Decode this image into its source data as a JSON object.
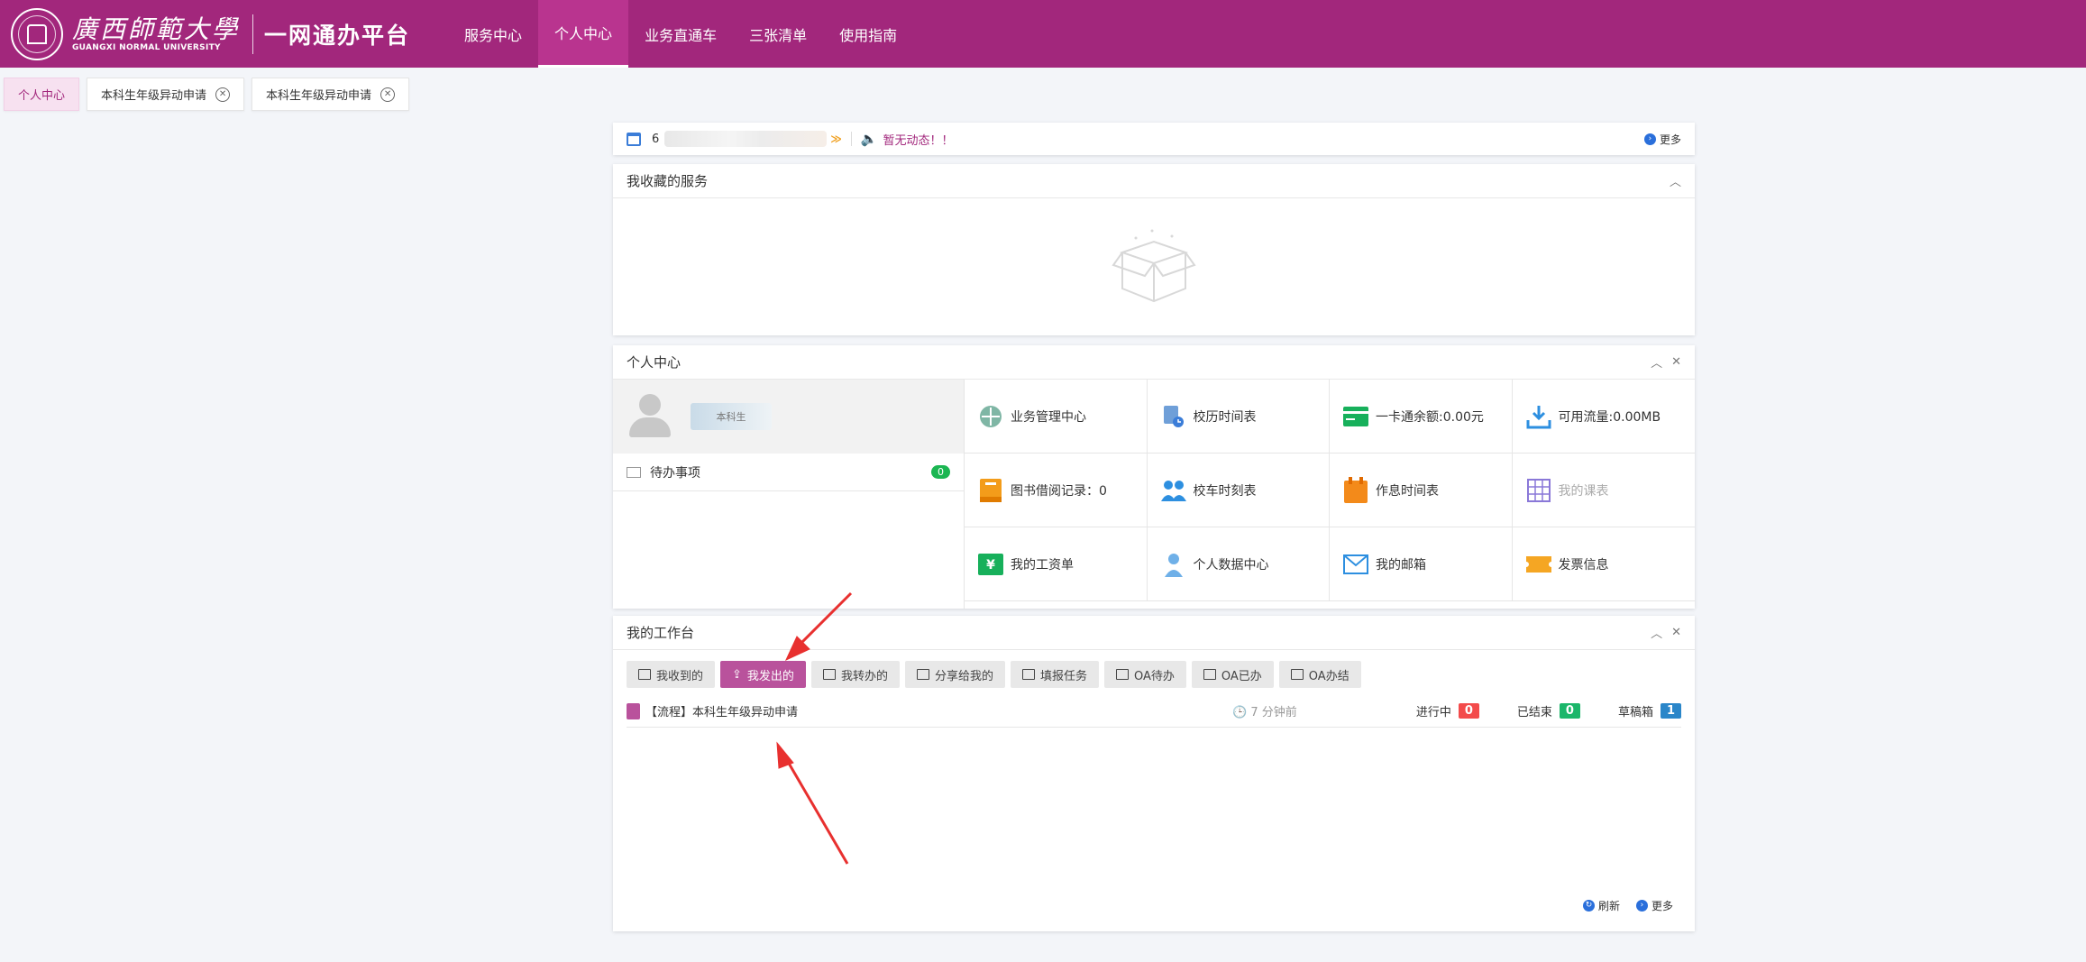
{
  "header": {
    "university_name": "廣西師範大學",
    "university_en": "GUANGXI NORMAL UNIVERSITY",
    "platform_title": "一网通办平台",
    "nav": [
      "服务中心",
      "个人中心",
      "业务直通车",
      "三张清单",
      "使用指南"
    ],
    "active_nav": "个人中心"
  },
  "tabs": [
    {
      "label": "个人中心",
      "active": true
    },
    {
      "label": "本科生年级异动申请",
      "active": false
    },
    {
      "label": "本科生年级异动申请",
      "active": false
    }
  ],
  "news": {
    "date_prefix": "6",
    "message": "暂无动态！！",
    "more": "更多"
  },
  "favorites": {
    "title": "我收藏的服务"
  },
  "personal": {
    "title": "个人中心",
    "user_role": "本科生",
    "todo_label": "待办事项",
    "todo_count": "0",
    "items": [
      {
        "label": "业务管理中心",
        "icon": "grid-circle-icon"
      },
      {
        "label": "校历时间表",
        "icon": "calendar-doc-icon"
      },
      {
        "label": "一卡通余额:0.00元",
        "icon": "card-icon"
      },
      {
        "label": "可用流量:0.00MB",
        "icon": "download-icon"
      },
      {
        "label": "图书借阅记录：0",
        "icon": "book-icon"
      },
      {
        "label": "校车时刻表",
        "icon": "people-icon"
      },
      {
        "label": "作息时间表",
        "icon": "schedule-icon"
      },
      {
        "label": "我的课表",
        "icon": "table-icon"
      },
      {
        "label": "我的工资单",
        "icon": "salary-icon"
      },
      {
        "label": "个人数据中心",
        "icon": "person-icon"
      },
      {
        "label": "我的邮箱",
        "icon": "envelope-icon"
      },
      {
        "label": "发票信息",
        "icon": "ticket-icon"
      }
    ]
  },
  "workbench": {
    "title": "我的工作台",
    "buttons": [
      "我收到的",
      "我发出的",
      "我转办的",
      "分享给我的",
      "填报任务",
      "OA待办",
      "OA已办",
      "OA办结"
    ],
    "active_button": "我发出的",
    "row": {
      "title": "【流程】本科生年级异动申请",
      "time": "7 分钟前"
    },
    "stats": [
      {
        "label": "进行中",
        "value": "0",
        "color": "red"
      },
      {
        "label": "已结束",
        "value": "0",
        "color": "green"
      },
      {
        "label": "草稿箱",
        "value": "1",
        "color": "blue"
      }
    ],
    "refresh": "刷新",
    "more": "更多"
  },
  "colors": {
    "brand": "#a2277c",
    "active_button": "#b9529c",
    "annotation_arrow": "#e8302f"
  }
}
